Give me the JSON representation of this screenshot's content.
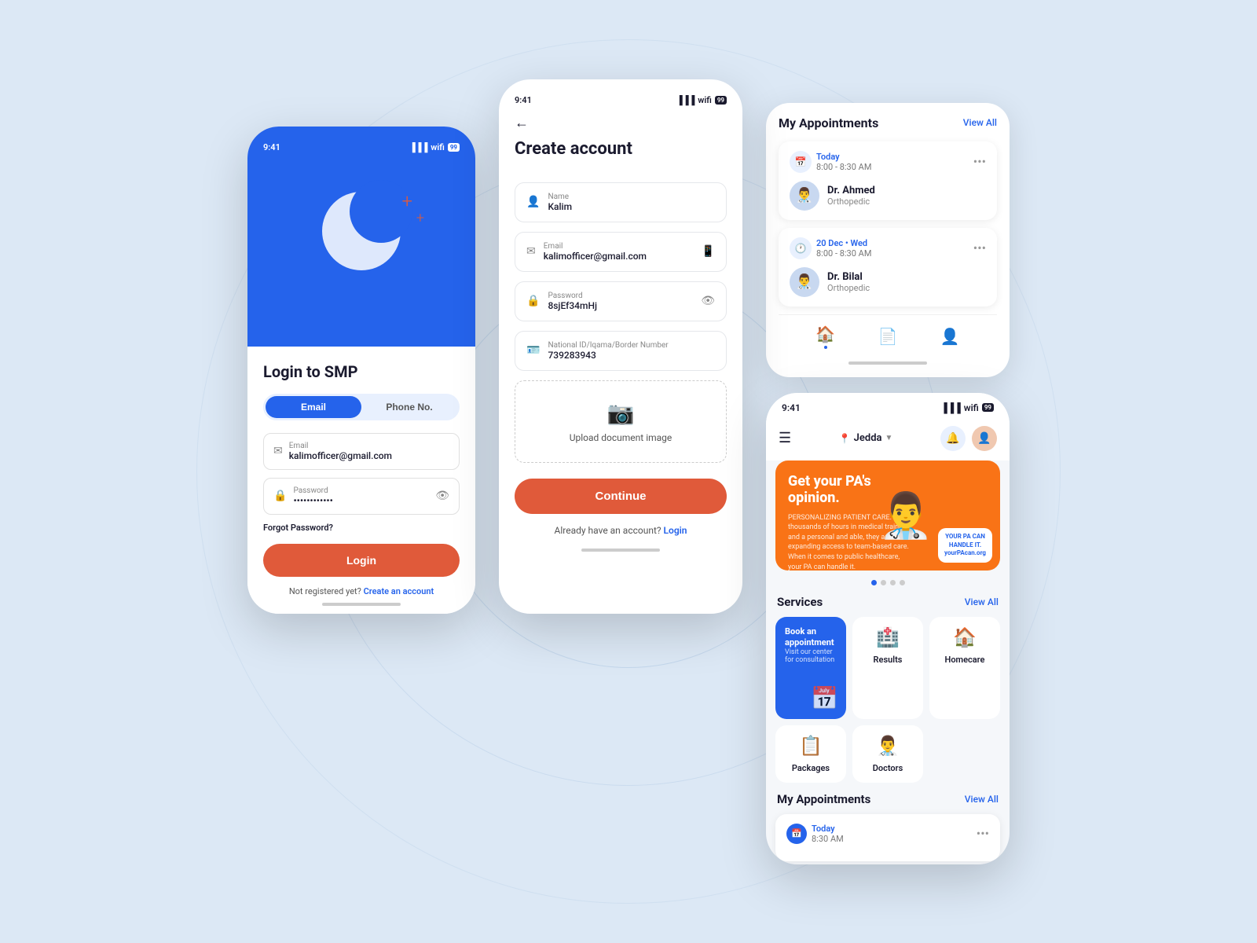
{
  "background": {
    "color": "#dce8f5"
  },
  "phone1": {
    "statusBar": {
      "time": "9:41",
      "battery": "99"
    },
    "title": "Login to SMP",
    "tabs": {
      "email": "Email",
      "phone": "Phone No."
    },
    "emailField": {
      "label": "Email",
      "value": "kalimofficer@gmail.com"
    },
    "passwordField": {
      "label": "Password",
      "value": "••••••••••••"
    },
    "forgotPassword": "Forgot Password?",
    "loginButton": "Login",
    "registerText": "Not registered yet?",
    "registerLink": "Create an account"
  },
  "phone2": {
    "statusBar": {
      "time": "9:41",
      "battery": "99"
    },
    "title": "Create account",
    "fields": [
      {
        "label": "Name",
        "value": "Kalim"
      },
      {
        "label": "Email",
        "value": "kalimofficer@gmail.com"
      },
      {
        "label": "Password",
        "value": "8sjEf34mHj"
      },
      {
        "label": "National ID/Iqama/Border Number",
        "value": "739283943"
      }
    ],
    "uploadLabel": "Upload document image",
    "continueButton": "Continue",
    "haveAccountText": "Already have an account?",
    "loginLink": "Login"
  },
  "phone3": {
    "appointmentsTitle": "My Appointments",
    "viewAll": "View All",
    "appointments": [
      {
        "dateLabel": "Today",
        "time": "8:00 - 8:30 AM",
        "doctorName": "Dr. Ahmed",
        "specialty": "Orthopedic"
      },
      {
        "dateLabel": "20 Dec • Wed",
        "time": "8:00 - 8:30 AM",
        "doctorName": "Dr. Bilal",
        "specialty": "Orthopedic"
      }
    ],
    "navItems": [
      "home",
      "documents",
      "profile"
    ]
  },
  "phone4": {
    "statusBar": {
      "time": "9:41",
      "battery": "99"
    },
    "location": "Jedda",
    "banner": {
      "headline": "Get your PA's opinion.",
      "sub": "PERSONALIZING PATIENT CARE. With thousands of hours in medical training and a personal and able, they are expanding access to team-based care. When it comes to public healthcare, your PA can handle it.",
      "badgeText": "YOUR PA CAN\nHANDLE IT.\nyourPAcan.org"
    },
    "services": {
      "title": "Services",
      "viewAll": "View All",
      "items": [
        {
          "label": "Book an appointment",
          "sub": "Visit our center for consultation",
          "type": "book"
        },
        {
          "label": "Results",
          "icon": "🏥"
        },
        {
          "label": "Homecare",
          "icon": "🏠"
        },
        {
          "label": "Packages",
          "icon": "📋"
        },
        {
          "label": "Doctors",
          "icon": "👨‍⚕️"
        }
      ]
    },
    "myAppointments": {
      "title": "My Appointments",
      "viewAll": "View All",
      "todayLabel": "Today",
      "todayTime": "8:30 AM"
    }
  }
}
